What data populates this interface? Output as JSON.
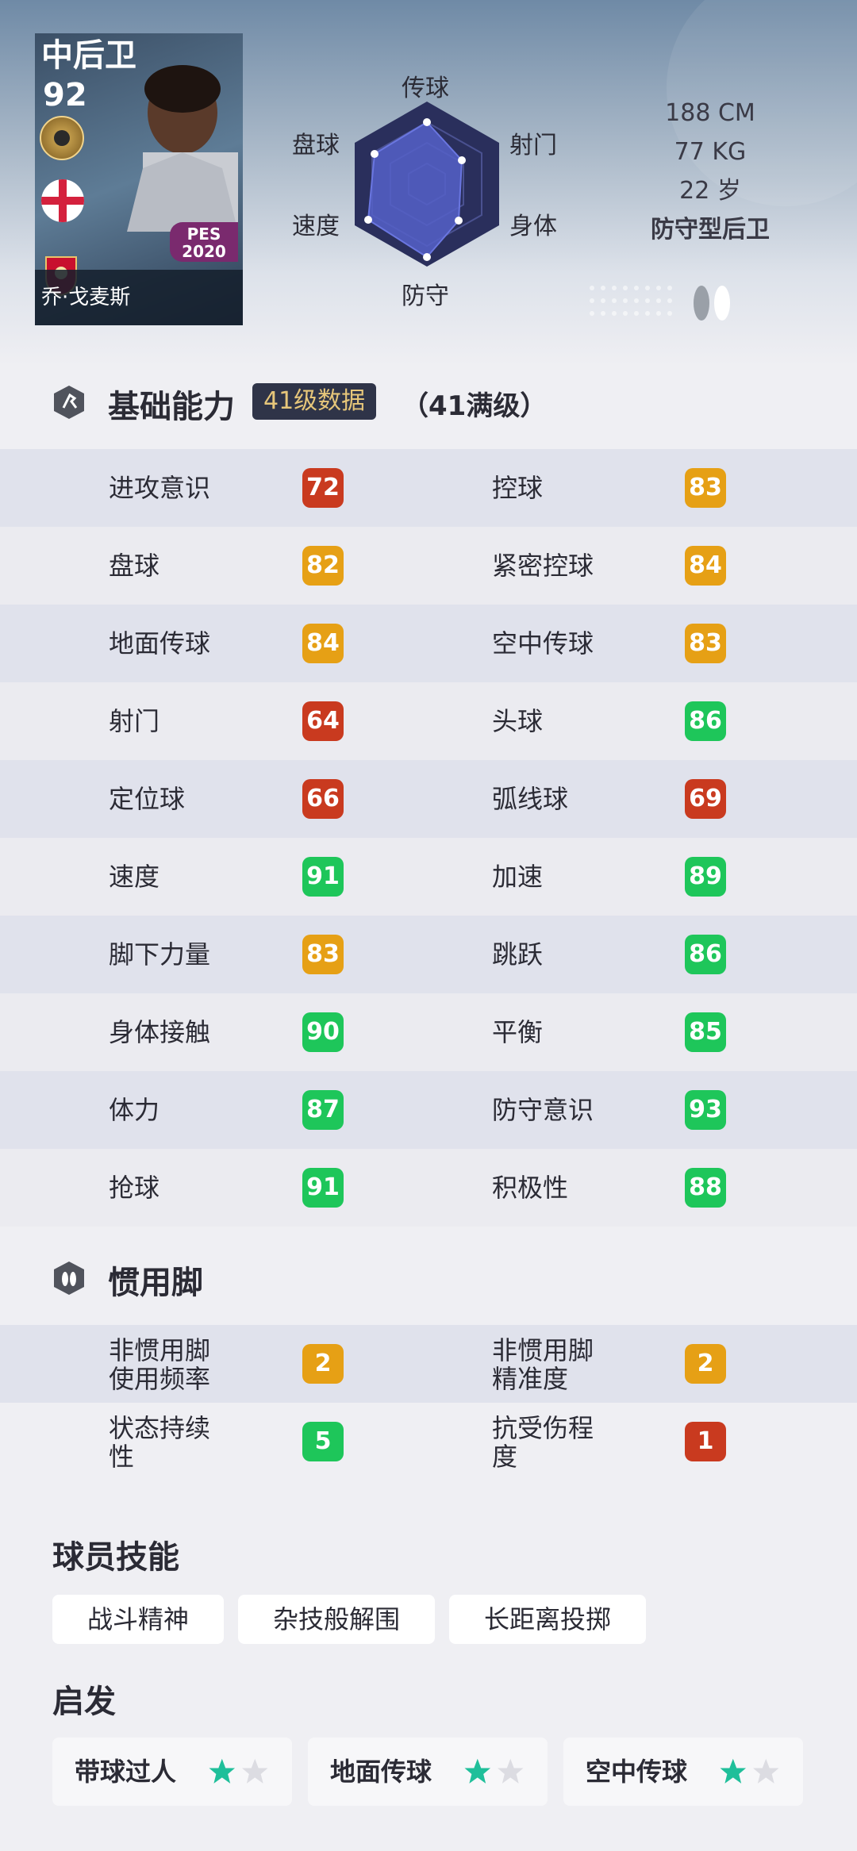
{
  "card": {
    "position": "中后卫",
    "rating": "92",
    "name": "乔·戈麦斯",
    "game_logo_line1": "PES",
    "game_logo_line2": "2020"
  },
  "radar": {
    "labels": {
      "top": "传球",
      "upper_left": "盘球",
      "upper_right": "射门",
      "lower_left": "速度",
      "lower_right": "身体",
      "bottom": "防守"
    },
    "fill_color": "#5560c8"
  },
  "physical": {
    "height": "188 CM",
    "weight": "77 KG",
    "age": "22 岁",
    "role": "防守型后卫"
  },
  "abilities": {
    "title": "基础能力",
    "level_tag": "41级数据",
    "max_level": "（41满级）",
    "stats": [
      {
        "left_label": "进攻意识",
        "left_value": "72",
        "left_color": "#c93a1f",
        "right_label": "控球",
        "right_value": "83",
        "right_color": "#e6a015"
      },
      {
        "left_label": "盘球",
        "left_value": "82",
        "left_color": "#e6a015",
        "right_label": "紧密控球",
        "right_value": "84",
        "right_color": "#e6a015"
      },
      {
        "left_label": "地面传球",
        "left_value": "84",
        "left_color": "#e6a015",
        "right_label": "空中传球",
        "right_value": "83",
        "right_color": "#e6a015"
      },
      {
        "left_label": "射门",
        "left_value": "64",
        "left_color": "#c93a1f",
        "right_label": "头球",
        "right_value": "86",
        "right_color": "#1ec65a"
      },
      {
        "left_label": "定位球",
        "left_value": "66",
        "left_color": "#c93a1f",
        "right_label": "弧线球",
        "right_value": "69",
        "right_color": "#c93a1f"
      },
      {
        "left_label": "速度",
        "left_value": "91",
        "left_color": "#1ec65a",
        "right_label": "加速",
        "right_value": "89",
        "right_color": "#1ec65a"
      },
      {
        "left_label": "脚下力量",
        "left_value": "83",
        "left_color": "#e6a015",
        "right_label": "跳跃",
        "right_value": "86",
        "right_color": "#1ec65a"
      },
      {
        "left_label": "身体接触",
        "left_value": "90",
        "left_color": "#1ec65a",
        "right_label": "平衡",
        "right_value": "85",
        "right_color": "#1ec65a"
      },
      {
        "left_label": "体力",
        "left_value": "87",
        "left_color": "#1ec65a",
        "right_label": "防守意识",
        "right_value": "93",
        "right_color": "#1ec65a"
      },
      {
        "left_label": "抢球",
        "left_value": "91",
        "left_color": "#1ec65a",
        "right_label": "积极性",
        "right_value": "88",
        "right_color": "#1ec65a"
      }
    ]
  },
  "foot": {
    "title": "惯用脚",
    "rows": [
      {
        "left_line1": "非惯用脚",
        "left_line2": "使用频率",
        "left_value": "2",
        "left_color": "#e6a015",
        "right_line1": "非惯用脚",
        "right_line2": "精准度",
        "right_value": "2",
        "right_color": "#e6a015"
      },
      {
        "left_line1": "状态持续",
        "left_line2": "性",
        "left_value": "5",
        "left_color": "#1ec65a",
        "right_line1": "抗受伤程",
        "right_line2": "度",
        "right_value": "1",
        "right_color": "#c93a1f"
      }
    ]
  },
  "skills": {
    "title": "球员技能",
    "items": [
      "战斗精神",
      "杂技般解围",
      "长距离投掷"
    ]
  },
  "starter": {
    "title": "启发",
    "items": [
      {
        "label": "带球过人",
        "stars_filled": 1,
        "stars_total": 2
      },
      {
        "label": "地面传球",
        "stars_filled": 1,
        "stars_total": 2
      },
      {
        "label": "空中传球",
        "stars_filled": 1,
        "stars_total": 2
      }
    ],
    "star_color": "#1fbf9a"
  }
}
